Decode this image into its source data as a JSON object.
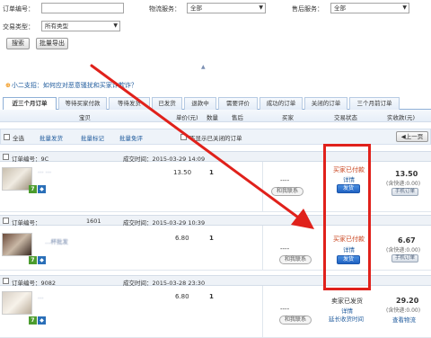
{
  "filters": {
    "order_no_label": "订单编号：",
    "logistics_label": "物流服务：",
    "logistics_value": "全部",
    "aftersale_label": "售后服务：",
    "aftersale_value": "全部",
    "trade_type_label": "交易类型：",
    "trade_type_value": "所有类型",
    "search_button": "搜索",
    "export_button": "批量导出"
  },
  "notice": "小二支招：如何应对恶意骚扰和买家诈欺诈？",
  "tabs": [
    "近三个月订单",
    "等待买家付款",
    "等待发货",
    "已发货",
    "退款中",
    "需要评价",
    "成功的订单",
    "关闭的订单",
    "三个月前订单"
  ],
  "columns": {
    "item": "宝贝",
    "unit_price": "单价(元)",
    "quantity": "数量",
    "aftersale": "售后",
    "buyer": "买家",
    "status": "交易状态",
    "paid": "实收款(元)"
  },
  "toolbar": {
    "select_all": "全选",
    "batch_ship": "批量发货",
    "batch_mark": "批量标记",
    "batch_free_eval": "批量免评",
    "no_show_closed": "不显示已关闭的订单",
    "prev_page": "上一页"
  },
  "orders": [
    {
      "order_no": "订单编号：9C",
      "deal_time": "成交时间：2015-03-29 14:09",
      "item_text": "… …",
      "price": "13.50",
      "qty": "1",
      "buyer_action": "和我联系",
      "buyer_dash": "----",
      "status": "买家已付款",
      "detail": "详情",
      "ship": "发货",
      "amount": "13.50",
      "shipfee": "(含快递:0.00)",
      "action": "手机订单"
    },
    {
      "order_no": "订单编号：",
      "order_suffix": "1601",
      "deal_time": "成交时间：2015-03-29 10:39",
      "item_text": "…杯批发",
      "price": "6.80",
      "qty": "1",
      "buyer_action": "和我联系",
      "buyer_dash": "----",
      "status": "买家已付款",
      "detail": "详情",
      "ship": "发货",
      "amount": "6.67",
      "shipfee": "(含快递:0.00)",
      "action": "手机订单"
    },
    {
      "order_no": "订单编号：9082",
      "deal_time": "成交时间：2015-03-28 23:30",
      "item_text": "…",
      "price": "6.80",
      "qty": "1",
      "buyer_action": "和我联系",
      "buyer_dash": "----",
      "status": "卖家已发货",
      "detail": "详情",
      "extend": "延长收货时间",
      "amount": "29.20",
      "shipfee": "(含快递:0.00)",
      "action": "查看物流"
    }
  ],
  "colors": {
    "highlight": "#e0211b",
    "link": "#1e5a9c",
    "status_red": "#c8421b"
  }
}
